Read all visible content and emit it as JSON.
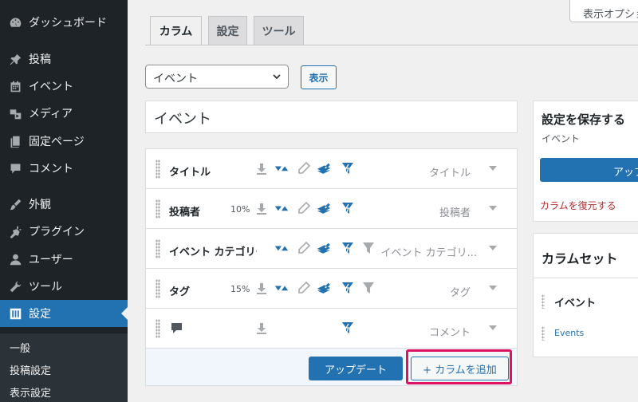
{
  "sidebar": {
    "items": [
      {
        "label": "ダッシュボード",
        "icon": "dashboard-icon"
      },
      {
        "label": "投稿",
        "icon": "pin-icon"
      },
      {
        "label": "イベント",
        "icon": "calendar-icon"
      },
      {
        "label": "メディア",
        "icon": "media-icon"
      },
      {
        "label": "固定ページ",
        "icon": "page-icon"
      },
      {
        "label": "コメント",
        "icon": "comment-icon"
      },
      {
        "label": "外観",
        "icon": "brush-icon"
      },
      {
        "label": "プラグイン",
        "icon": "plugin-icon"
      },
      {
        "label": "ユーザー",
        "icon": "user-icon"
      },
      {
        "label": "ツール",
        "icon": "wrench-icon"
      },
      {
        "label": "設定",
        "icon": "settings-icon"
      }
    ],
    "submenu": [
      "一般",
      "投稿設定",
      "表示設定"
    ]
  },
  "screen_options": "表示オプション",
  "tabs": [
    "カラム",
    "設定",
    "ツール"
  ],
  "list_select": {
    "value": "イベント"
  },
  "show_button": "表示",
  "list_title": "イベント",
  "columns": [
    {
      "label": "タイトル",
      "width": "",
      "type": "タイトル"
    },
    {
      "label": "投稿者",
      "width": "10%",
      "type": "投稿者"
    },
    {
      "label": "イベント カテゴリー",
      "width": "",
      "type": "イベント カテゴリ..."
    },
    {
      "label": "タグ",
      "width": "15%",
      "type": "タグ"
    },
    {
      "label": "",
      "width": "",
      "type": "コメント"
    }
  ],
  "update_button": "アップデート",
  "add_column_button": "+ カラムを追加",
  "save_panel": {
    "title": "設定を保存する",
    "subtitle": "イベント",
    "update_button": "アップデート",
    "restore_link": "カラムを復元する"
  },
  "column_set_panel": {
    "title": "カラムセット",
    "item": "イベント",
    "link": "Events"
  },
  "colors": {
    "accent": "#2271b1",
    "sidebar_bg": "#1d2327",
    "highlight": "#e0115f",
    "danger": "#b32d2e"
  }
}
